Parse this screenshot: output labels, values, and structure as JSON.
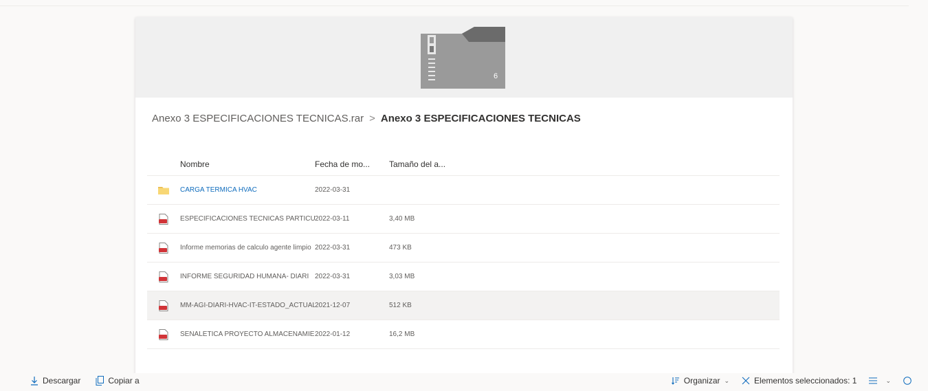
{
  "breadcrumb": {
    "parent": "Anexo 3 ESPECIFICACIONES TECNICAS.rar",
    "separator": ">",
    "current": "Anexo 3 ESPECIFICACIONES TECNICAS"
  },
  "thumbnail": {
    "count": "6",
    "icon": "zip-folder-icon"
  },
  "list": {
    "columns": {
      "name": "Nombre",
      "date": "Fecha de mo...",
      "size": "Tamaño del a..."
    },
    "rows": [
      {
        "type": "folder",
        "name": "CARGA TERMICA HVAC",
        "date": "2022-03-31",
        "size": ""
      },
      {
        "type": "pdf",
        "name": "ESPECIFICACIONES TECNICAS PARTICULARES",
        "date": "2022-03-11",
        "size": "3,40 MB"
      },
      {
        "type": "pdf",
        "name": "Informe memorias de calculo agente limpio",
        "date": "2022-03-31",
        "size": "473 KB"
      },
      {
        "type": "pdf",
        "name": "INFORME SEGURIDAD HUMANA- DIARI",
        "date": "2022-03-31",
        "size": "3,03 MB"
      },
      {
        "type": "pdf",
        "name": "MM-AGI-DIARI-HVAC-IT-ESTADO_ACTUAL",
        "date": "2021-12-07",
        "size": "512 KB"
      },
      {
        "type": "pdf",
        "name": "SEÑALETICA PROYECTO ALMACENAMIENTO",
        "date": "2022-01-12",
        "size": "16,2 MB"
      }
    ]
  },
  "commands": {
    "download": "Descargar",
    "copy_to": "Copiar a",
    "sort": "Organizar",
    "selected": "Elementos seleccionados: 1"
  },
  "colors": {
    "link": "#0f6cbd",
    "folder": "#f8d775",
    "pdf": "#d13438"
  }
}
